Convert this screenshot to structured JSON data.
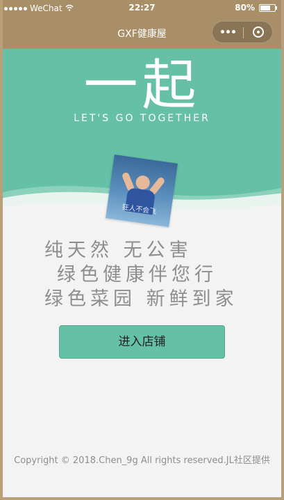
{
  "status_bar": {
    "carrier": "WeChat",
    "time": "22:27",
    "battery": "80%",
    "battery_level": 0.8
  },
  "nav_bar": {
    "title": "GXF健康屋"
  },
  "hero": {
    "heading": "一起",
    "tagline": "LET'S GO TOGETHER",
    "avatar_caption": "狂人不会飞"
  },
  "slogans": [
    "纯天然  无公害",
    "绿色健康伴您行",
    "绿色菜园   新鲜到家"
  ],
  "enter_button": {
    "label": "进入店铺"
  },
  "footer": {
    "copyright": "Copyright © 2018.Chen_9g All rights reserved.JL社区提供"
  },
  "colors": {
    "nav_bg": "#a88f68",
    "accent": "#65c0a5",
    "text_muted": "#8e8e8e"
  }
}
